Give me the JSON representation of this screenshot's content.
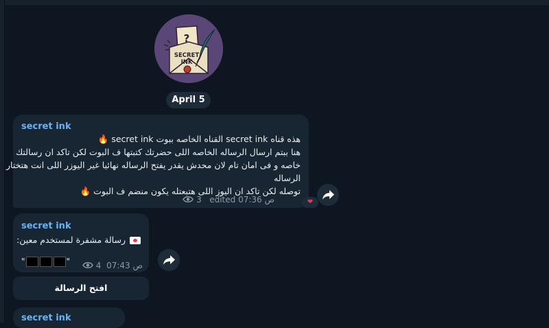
{
  "channel": {
    "date_label": "April 5",
    "logo_text_line1": "SECRET",
    "logo_text_line2": "INK",
    "logo_mark": "?"
  },
  "messages": [
    {
      "sender": "secret ink",
      "lines": [
        "هذه قناه secret ink القناه الخاصه ببوت secret ink",
        "هنا ببتم ارسال الرساله الخاصه اللى حضرتك كتبتها ف البوت لكن تاكد ان رسالتك",
        "خاصه و فى امان تام لان محدش يقدر يفتح الرساله نهائيا غير اليوزر اللى انت هتختار",
        "الرساله",
        "توصله لكن تاكد ان اليوز اللى هتبعتله يكون منضم ف البوت"
      ],
      "edited": "edited",
      "time": "07:36 ص",
      "views": "3",
      "reaction": "❤"
    },
    {
      "sender": "secret ink",
      "text": "رسالة مشفرة لمستخدم معين:",
      "quote_open": "\"",
      "quote_close": "\"",
      "time": "07:43 ص",
      "views": "4",
      "button_label": "افتح الرسالة"
    },
    {
      "sender": "secret ink"
    }
  ],
  "icons": {
    "fire": "🔥",
    "eye": "eye-icon",
    "forward": "share-arrow-icon",
    "envelope": "love-letter-icon"
  },
  "colors": {
    "background": "#0e1621",
    "bubble": "#182533",
    "sender": "#6ab3f3",
    "meta": "#8a9aa9",
    "avatar": "#5b4777"
  }
}
